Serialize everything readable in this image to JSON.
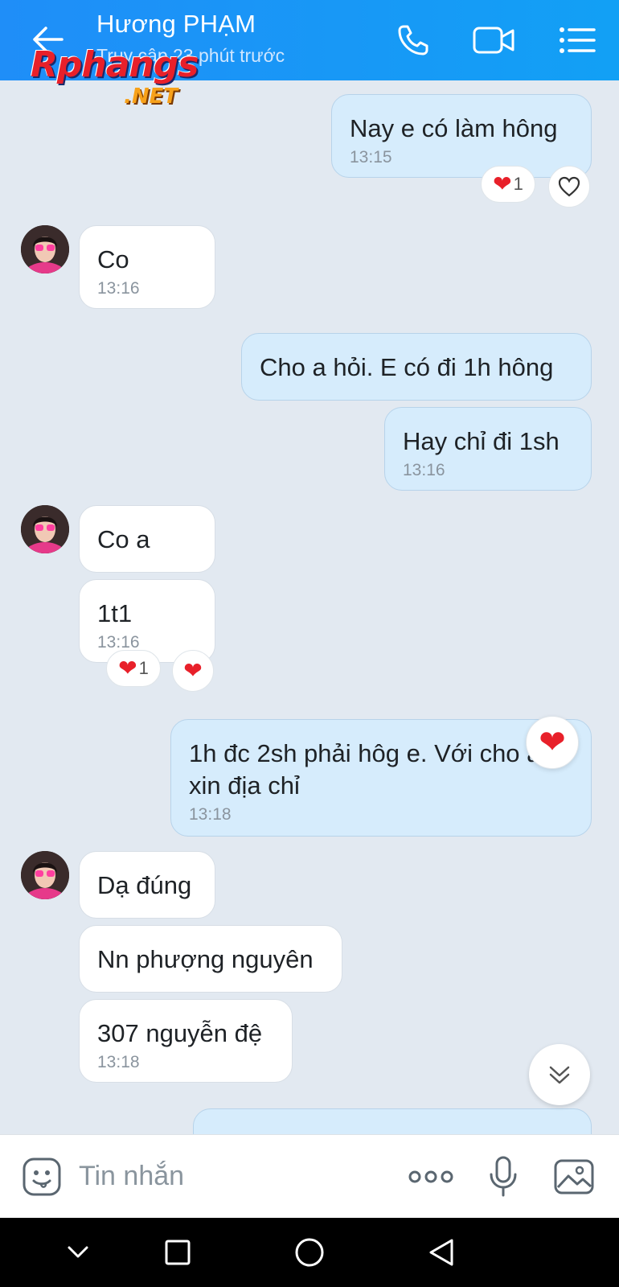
{
  "header": {
    "contact_name": "Hương PHẠM",
    "status": "Truy cập 23 phút trước",
    "watermark_main": "Rphangs",
    "watermark_sub": ".NET",
    "icons": [
      "back-arrow-icon",
      "phone-icon",
      "video-call-icon",
      "menu-list-icon"
    ]
  },
  "messages": [
    {
      "side": "sent",
      "text": "Nay e có làm hông",
      "time": "13:15",
      "reactions": [
        "1"
      ]
    },
    {
      "side": "recv",
      "text": "Co",
      "time": "13:16"
    },
    {
      "side": "sent",
      "text": "Cho a hỏi. E có đi 1h hông",
      "time": ""
    },
    {
      "side": "sent",
      "text": "Hay chỉ đi 1sh",
      "time": "13:16"
    },
    {
      "side": "recv",
      "text": "Co a",
      "time": ""
    },
    {
      "side": "recv",
      "text": "1t1",
      "time": "13:16",
      "reactions": [
        "1"
      ]
    },
    {
      "side": "sent",
      "text_line1": "1h đc 2sh phải hôg e. Với cho a",
      "text_line2": "xin địa chỉ",
      "time": "13:18"
    },
    {
      "side": "recv",
      "text": "Dạ đúng",
      "time": ""
    },
    {
      "side": "recv",
      "text": "Nn phượng nguyên",
      "time": ""
    },
    {
      "side": "recv",
      "text": "307 nguyễn đệ",
      "time": "13:18"
    }
  ],
  "composer": {
    "placeholder": "Tin nhắn",
    "icons": [
      "sticker-icon",
      "more-dots-icon",
      "microphone-icon",
      "image-icon"
    ]
  },
  "colors": {
    "header": "#1f8ef8",
    "sent_bubble": "#d6ecfc",
    "recv_bubble": "#ffffff",
    "background": "#e2e9f1",
    "heart": "#e8202a"
  }
}
